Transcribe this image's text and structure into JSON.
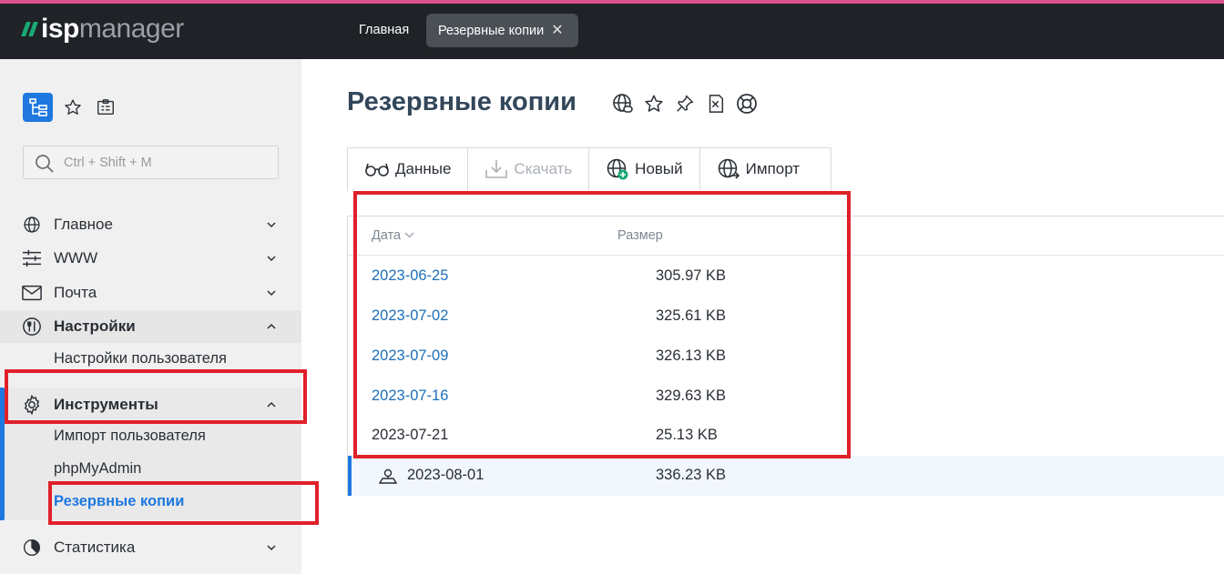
{
  "app": {
    "logo_primary": "isp",
    "logo_secondary": "manager",
    "tabs": [
      {
        "label": "Главная"
      },
      {
        "label": "Резервные копии",
        "close": "✕"
      }
    ]
  },
  "sidebar": {
    "search_placeholder": "Ctrl + Shift + M",
    "sections": {
      "main": "Главное",
      "www": "WWW",
      "mail": "Почта",
      "settings": "Настройки",
      "settings_user": "Настройки пользователя",
      "tools": "Инструменты",
      "tools_import": "Импорт пользователя",
      "tools_pma": "phpMyAdmin",
      "tools_backup": "Резервные копии",
      "stats": "Статистика"
    }
  },
  "page": {
    "title": "Резервные копии",
    "toolbar": {
      "data": "Данные",
      "download": "Скачать",
      "new": "Новый",
      "import": "Импорт"
    },
    "table": {
      "columns": [
        "Дата",
        "Размер"
      ],
      "rows": [
        {
          "date": "2023-06-25",
          "size": "305.97 KB"
        },
        {
          "date": "2023-07-02",
          "size": "325.61 KB"
        },
        {
          "date": "2023-07-09",
          "size": "326.13 KB"
        },
        {
          "date": "2023-07-16",
          "size": "329.63 KB"
        },
        {
          "date": "2023-07-21",
          "size": "25.13 KB"
        },
        {
          "date": "2023-08-01",
          "size": "336.23 KB"
        }
      ]
    }
  },
  "colors": {
    "accent": "#1e78e0",
    "highlight": "#e0202a",
    "topbar": "#1f2226",
    "brand_green": "#19a974"
  }
}
